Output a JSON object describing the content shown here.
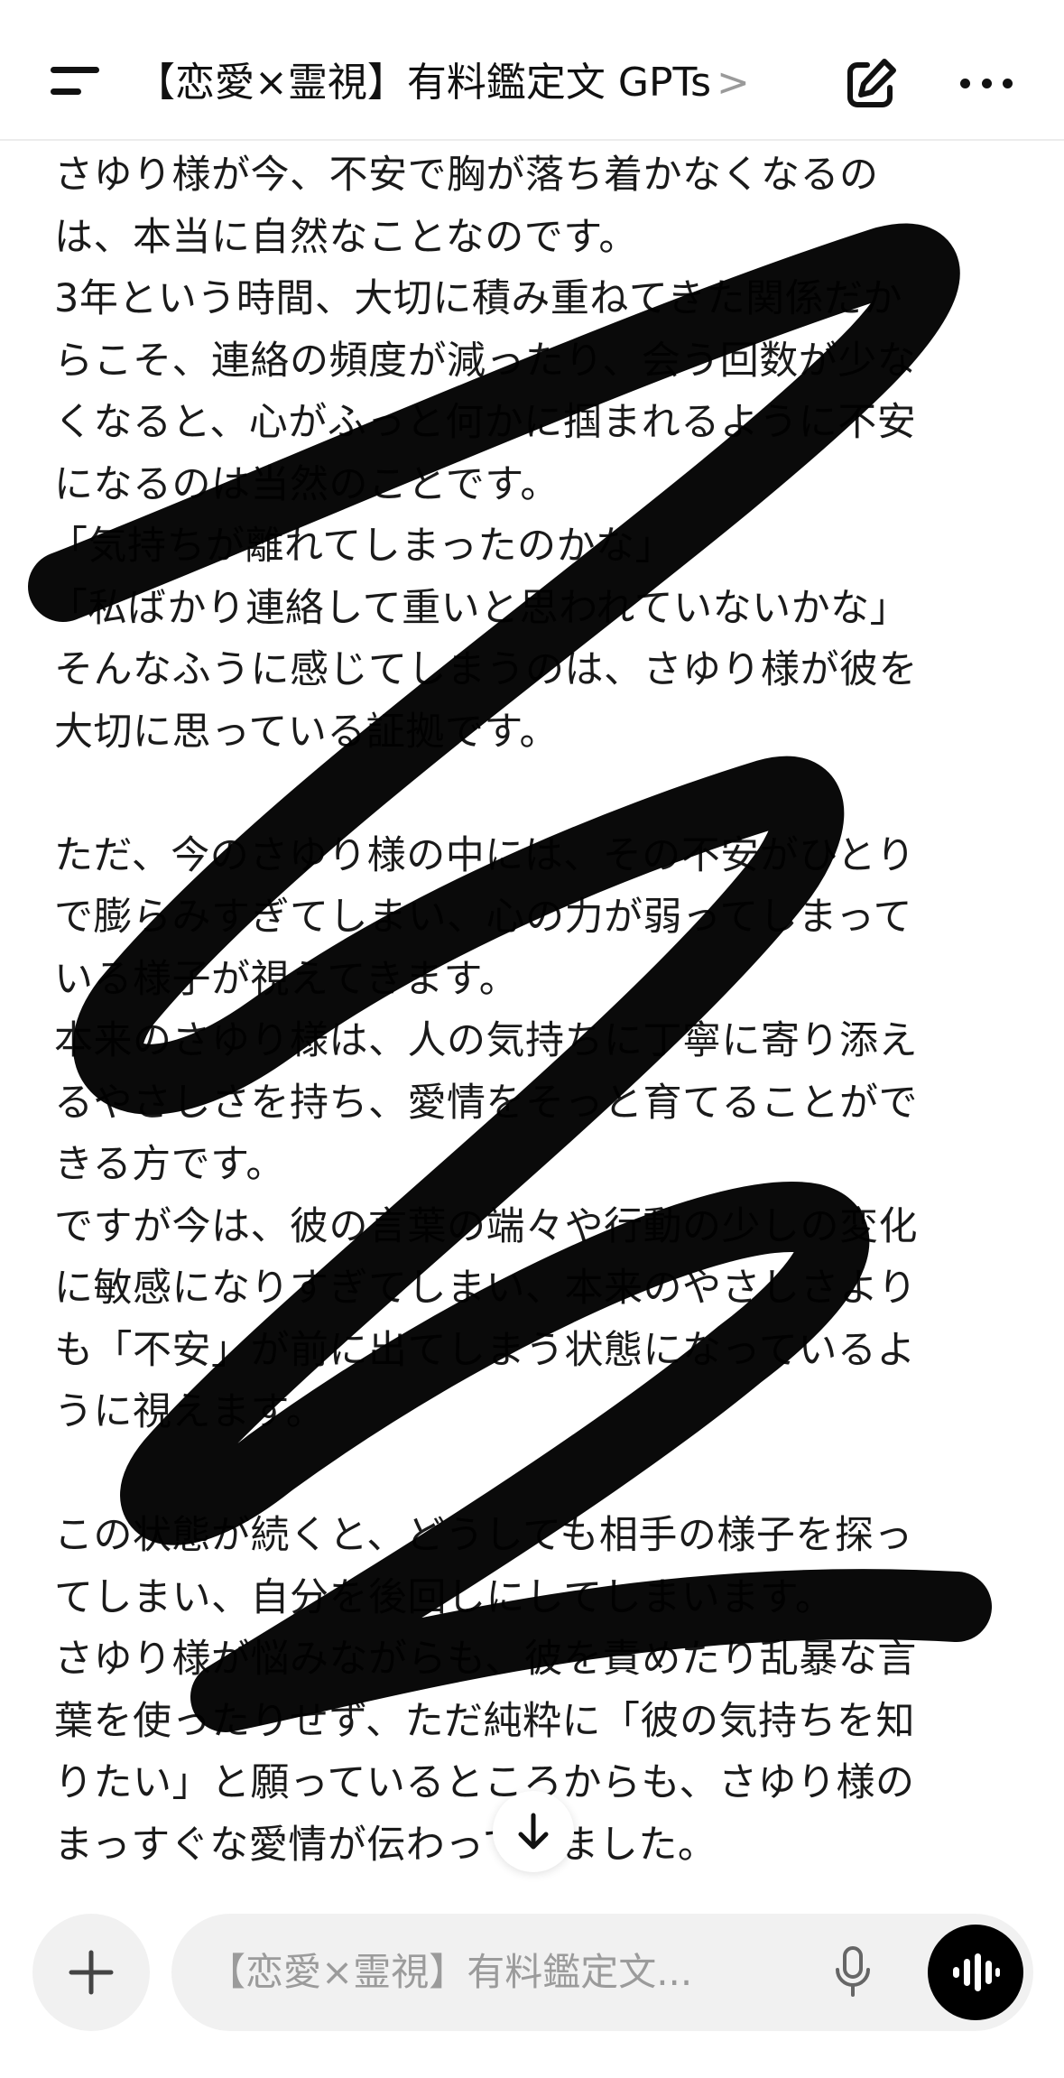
{
  "header": {
    "title": "【恋愛×霊視】有料鑑定文 GPTs",
    "chevron": ">",
    "menu_icon": "hamburger-icon",
    "edit_icon": "compose-icon",
    "more_icon": "more-icon"
  },
  "message": {
    "lines": [
      "さゆり様が今、不安で胸が落ち着かなくなるの",
      "は、本当に自然なことなのです。",
      "3年という時間、大切に積み重ねてきた関係だか",
      "らこそ、連絡の頻度が減ったり、会う回数が少な",
      "くなると、心がふっと何かに掴まれるように不安",
      "になるのは当然のことです。",
      "「気持ちが離れてしまったのかな」",
      "「私ばかり連絡して重いと思われていないかな」",
      "そんなふうに感じてしまうのは、さゆり様が彼を",
      "大切に思っている証拠です。",
      "",
      "ただ、今のさゆり様の中には、その不安がひとり",
      "で膨らみすぎてしまい、心の力が弱ってしまって",
      "いる様子が視えてきます。",
      "本来のさゆり様は、人の気持ちに丁寧に寄り添え",
      "るやさしさを持ち、愛情をそっと育てることがで",
      "きる方です。",
      "ですが今は、彼の言葉の端々や行動の少しの変化",
      "に敏感になりすぎてしまい、本来のやさしさより",
      "も「不安」が前に出てしまう状態になっているよ",
      "うに視えます。",
      "",
      "この状態が続くと、どうしても相手の様子を探っ",
      "てしまい、自分を後回しにしてしまいます。",
      "さゆり様が悩みながらも、彼を責めたり乱暴な言",
      "葉を使ったりせず、ただ純粋に「彼の気持ちを知",
      "りたい」と願っているところからも、さゆり様の",
      "まっすぐな愛情が伝わってきました。"
    ]
  },
  "composer": {
    "placeholder": "【恋愛×霊視】有料鑑定文...",
    "plus_icon": "plus-icon",
    "mic_icon": "microphone-icon",
    "voice_icon": "voice-mode-icon"
  },
  "scroll": {
    "icon": "arrow-down-icon"
  },
  "overlay": {
    "description_color": "#000000"
  }
}
